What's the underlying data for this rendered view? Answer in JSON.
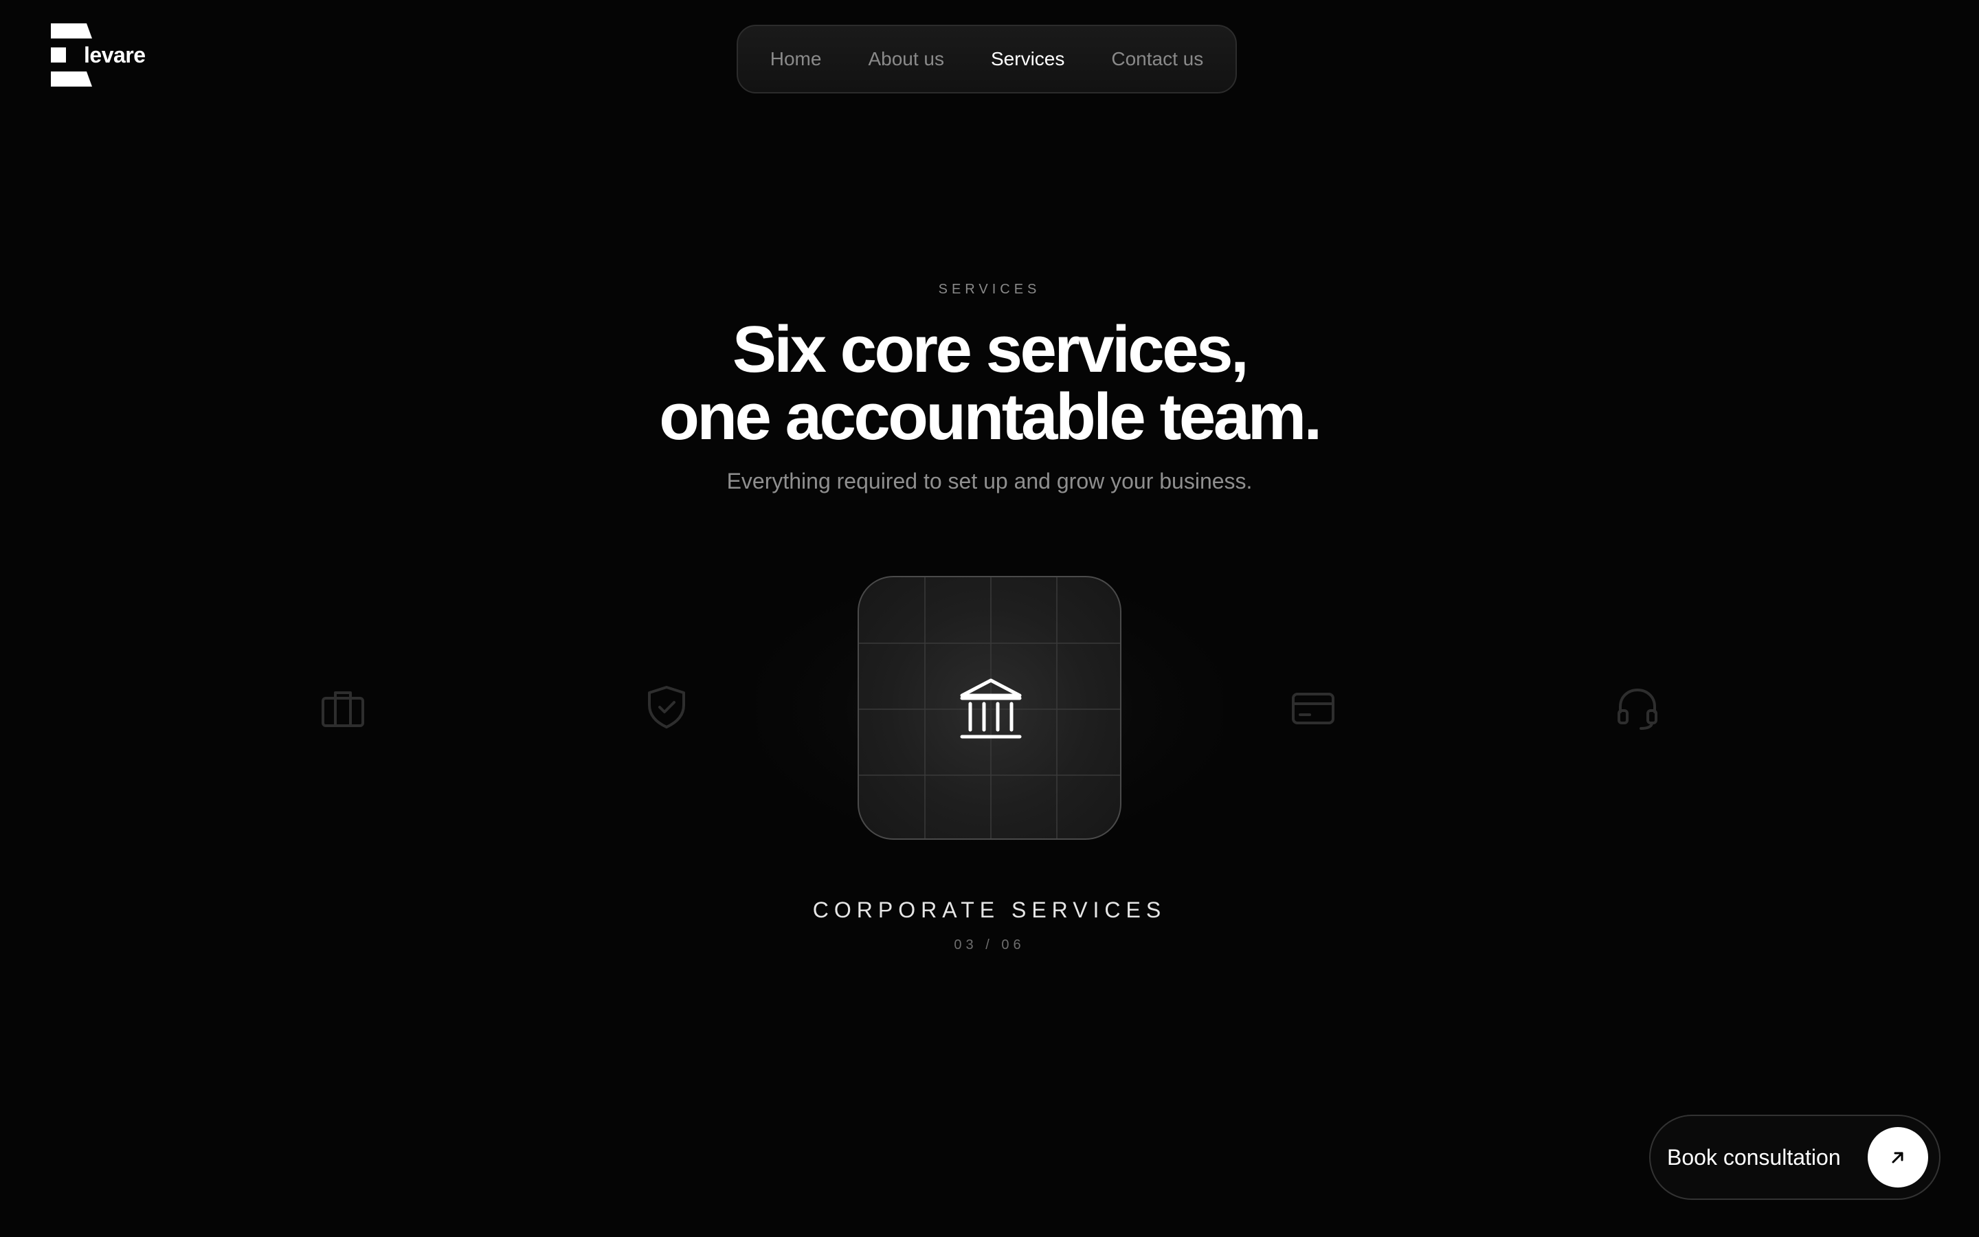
{
  "brand": {
    "name": "levare",
    "logo_icon": "e-stack-logo-icon"
  },
  "nav": {
    "items": [
      {
        "label": "Home",
        "active": false
      },
      {
        "label": "About us",
        "active": false
      },
      {
        "label": "Services",
        "active": true
      },
      {
        "label": "Contact us",
        "active": false
      }
    ]
  },
  "hero": {
    "eyebrow": "SERVICES",
    "headline_line1": "Six core services,",
    "headline_line2": "one accountable team.",
    "subline": "Everything required to set up and grow your business."
  },
  "carousel": {
    "active_icon": "bank-icon",
    "side_icons": [
      "briefcase-icon",
      "shield-check-icon",
      "credit-card-icon",
      "headset-icon"
    ],
    "active_title": "CORPORATE SERVICES",
    "counter": "03 / 06"
  },
  "cta": {
    "label": "Book consultation",
    "icon": "arrow-up-right-icon"
  },
  "colors": {
    "background": "#050505",
    "text": "#ffffff",
    "muted": "#8a8a8a",
    "card_border": "#4a4a4a"
  }
}
